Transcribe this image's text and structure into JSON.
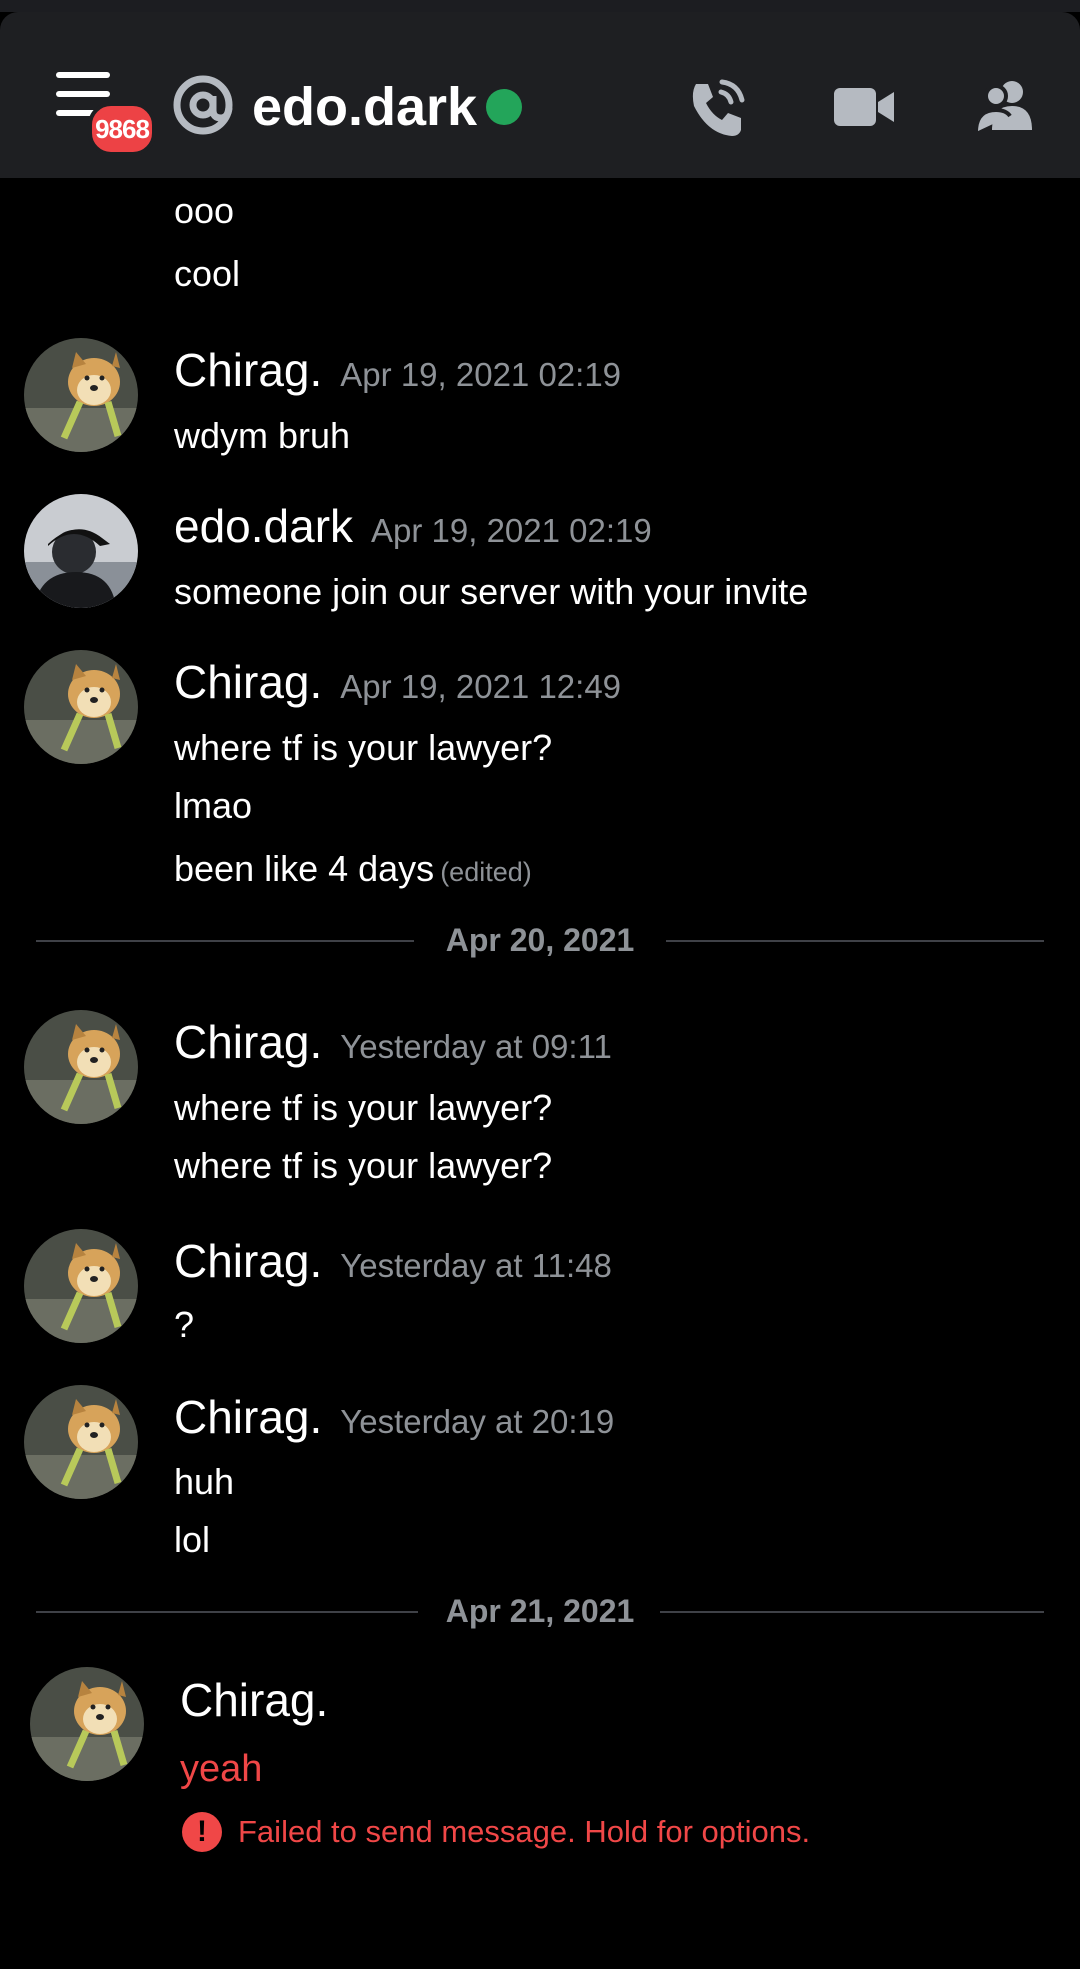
{
  "header": {
    "channel_name": "edo.dark",
    "notification_count": "9868",
    "status": "online",
    "icons": [
      "menu-icon",
      "at-icon",
      "call-icon",
      "video-icon",
      "members-icon"
    ]
  },
  "messages": [
    {
      "lines": [
        "ooo",
        "cool"
      ]
    },
    {
      "author": "Chirag.",
      "timestamp": "Apr 19, 2021 02:19",
      "lines": [
        "wdym bruh"
      ]
    },
    {
      "author": "edo.dark",
      "timestamp": "Apr 19, 2021 02:19",
      "lines": [
        "someone join our server with your invite"
      ]
    },
    {
      "author": "Chirag.",
      "timestamp": "Apr 19, 2021 12:49",
      "lines": [
        "where tf is your lawyer?",
        "lmao",
        "been like 4 days"
      ],
      "edited_label": "(edited)"
    },
    {
      "author": "Chirag.",
      "timestamp": "Yesterday at 09:11",
      "lines": [
        "where tf is your lawyer?",
        "where tf is your lawyer?"
      ]
    },
    {
      "author": "Chirag.",
      "timestamp": "Yesterday at 11:48",
      "lines": [
        "?"
      ]
    },
    {
      "author": "Chirag.",
      "timestamp": "Yesterday at 20:19",
      "lines": [
        "huh",
        "lol"
      ]
    },
    {
      "author": "Chirag.",
      "lines": [
        "yeah"
      ],
      "error": "Failed to send message. Hold for options."
    }
  ],
  "dividers": [
    "Apr 20, 2021",
    "Apr 21, 2021"
  ],
  "colors": {
    "background": "#000000",
    "header": "#1e1f22",
    "online": "#23a55a",
    "badge": "#ed4245",
    "error": "#f04747",
    "muted": "#8e9297"
  }
}
